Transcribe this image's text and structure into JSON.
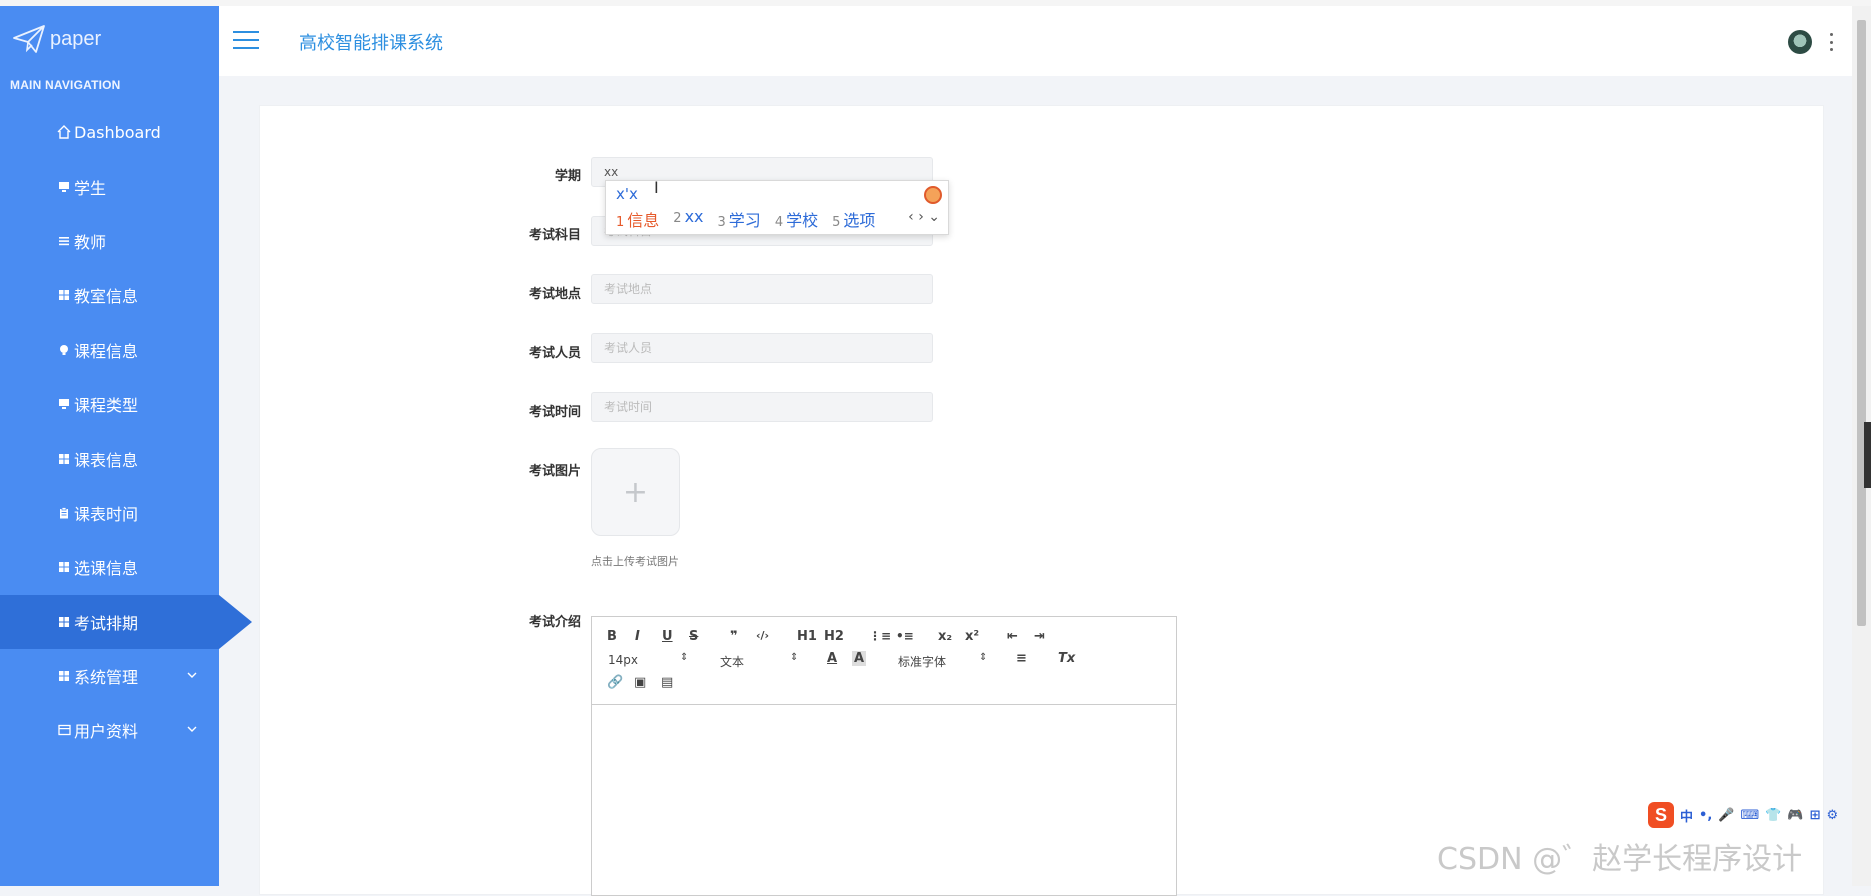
{
  "app": {
    "logo_text": "paper",
    "title": "高校智能排课系统"
  },
  "sidebar": {
    "header": "MAIN NAVIGATION",
    "items": [
      {
        "label": "Dashboard",
        "icon": "home-icon"
      },
      {
        "label": "学生",
        "icon": "monitor-icon"
      },
      {
        "label": "教师",
        "icon": "list-icon"
      },
      {
        "label": "教室信息",
        "icon": "grid-icon"
      },
      {
        "label": "课程信息",
        "icon": "bulb-icon"
      },
      {
        "label": "课程类型",
        "icon": "monitor-icon"
      },
      {
        "label": "课表信息",
        "icon": "grid-icon"
      },
      {
        "label": "课表时间",
        "icon": "clipboard-icon"
      },
      {
        "label": "选课信息",
        "icon": "grid-icon"
      },
      {
        "label": "考试排期",
        "icon": "grid-icon",
        "active": true
      },
      {
        "label": "系统管理",
        "icon": "grid-icon",
        "expandable": true
      },
      {
        "label": "用户资料",
        "icon": "card-icon",
        "expandable": true
      }
    ]
  },
  "form": {
    "semester": {
      "label": "学期",
      "value": "xx"
    },
    "subject": {
      "label": "考试科目",
      "placeholder": "考试科目"
    },
    "location": {
      "label": "考试地点",
      "placeholder": "考试地点"
    },
    "staff": {
      "label": "考试人员",
      "placeholder": "考试人员"
    },
    "time": {
      "label": "考试时间",
      "placeholder": "考试时间"
    },
    "image": {
      "label": "考试图片",
      "hint": "点击上传考试图片",
      "plus": "+"
    },
    "intro": {
      "label": "考试介绍"
    }
  },
  "ime": {
    "composition": "x'x",
    "candidates": [
      {
        "n": "1",
        "text": "信息"
      },
      {
        "n": "2",
        "text": "xx"
      },
      {
        "n": "3",
        "text": "学习"
      },
      {
        "n": "4",
        "text": "学校"
      },
      {
        "n": "5",
        "text": "选项"
      }
    ],
    "arrows": "‹ › ⌄"
  },
  "editor": {
    "row1": [
      "B",
      "I",
      "U",
      "S",
      "❞",
      "‹/›",
      "H1",
      "H2",
      "⋮≡",
      "•≡",
      "x₂",
      "x²",
      "⇤",
      "⇥"
    ],
    "font_size": "14px",
    "block_type": "文本",
    "font_family": "标准字体",
    "color_a": "A",
    "clear_format": "Tx"
  },
  "tray": {
    "logo": "S",
    "items": [
      "中",
      "•,",
      "🎤",
      "⌨",
      "👕",
      "🎮",
      "⊞",
      "⚙"
    ]
  },
  "watermark": "CSDN @゛赵学长程序设计"
}
